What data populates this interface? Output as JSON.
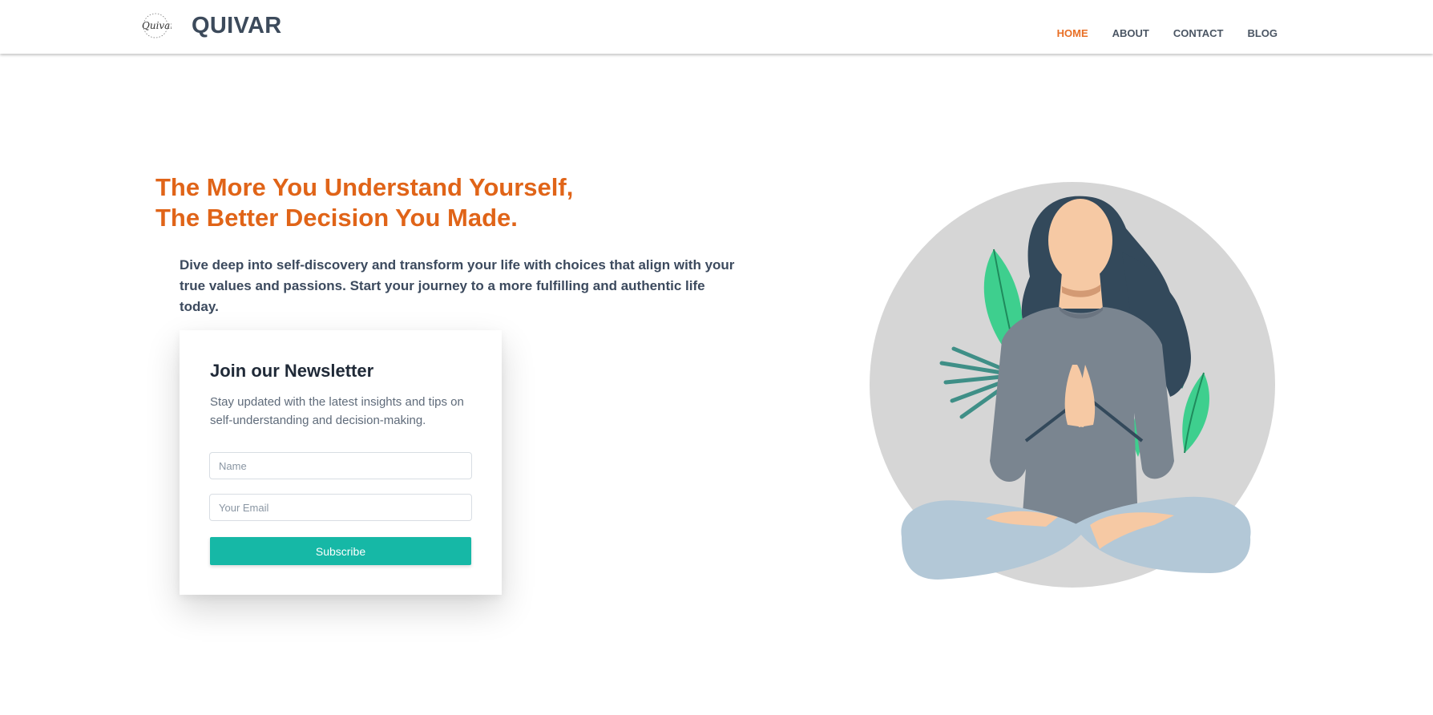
{
  "header": {
    "brand": "QUIVAR",
    "logo_script": "Quivar",
    "nav": [
      {
        "label": "HOME",
        "active": true
      },
      {
        "label": "ABOUT",
        "active": false
      },
      {
        "label": "CONTACT",
        "active": false
      },
      {
        "label": "BLOG",
        "active": false
      }
    ]
  },
  "hero": {
    "title_line1": "The More You Understand Yourself,",
    "title_line2": "The Better Decision You Made.",
    "subtitle": "Dive deep into self-discovery and transform your life with choices that align with your true values and passions. Start your journey to a more fulfilling and authentic life today."
  },
  "newsletter": {
    "title": "Join our Newsletter",
    "description": "Stay updated with the latest insights and tips on self-understanding and decision-making.",
    "name_placeholder": "Name",
    "email_placeholder": "Your Email",
    "button_label": "Subscribe"
  },
  "colors": {
    "accent_orange": "#e06418",
    "nav_active": "#e86f26",
    "button_teal": "#16b8a6",
    "text_dark": "#3c4a5b"
  },
  "icons": {
    "logo": "script-logo-icon",
    "illustration": "meditating-woman-illustration"
  }
}
